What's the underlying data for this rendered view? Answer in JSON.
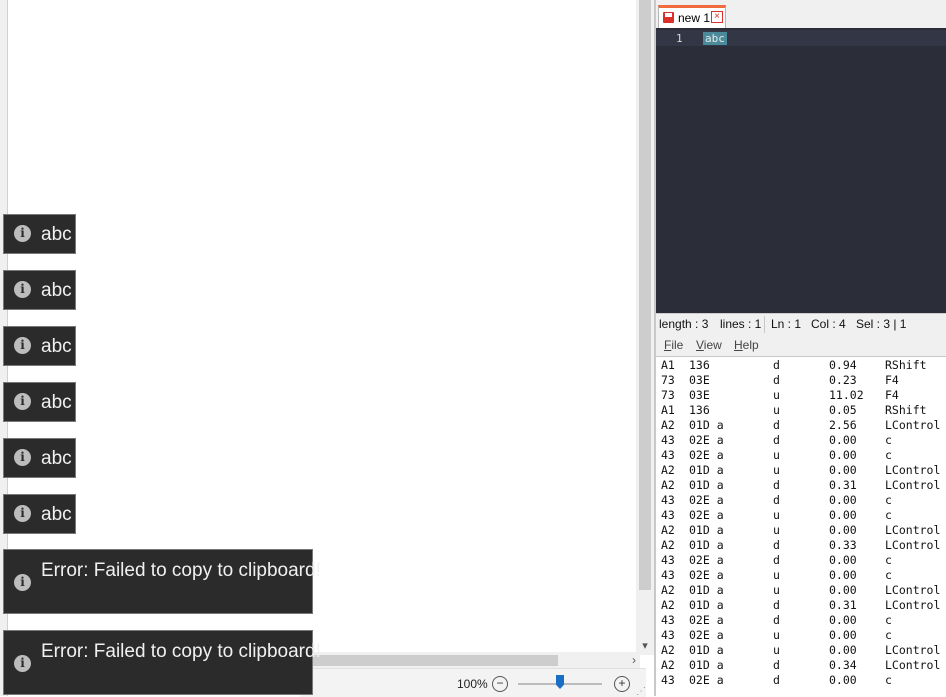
{
  "toasts": [
    {
      "message": "abc"
    },
    {
      "message": "abc"
    },
    {
      "message": "abc"
    },
    {
      "message": "abc"
    },
    {
      "message": "abc"
    },
    {
      "message": "abc"
    },
    {
      "message": "Error: Failed to copy to clipboard!"
    },
    {
      "message": "Error: Failed to copy to clipboard!"
    }
  ],
  "viewer": {
    "zoom": "100%",
    "zoom_minus": "−",
    "zoom_plus": "+"
  },
  "editor": {
    "tab_label": "new 1",
    "line_number": "1",
    "line_text": "abc",
    "status": {
      "length": "length : 3",
      "lines": "lines : 1",
      "ln": "Ln : 1",
      "col": "Col : 4",
      "sel": "Sel : 3 | 1"
    }
  },
  "key_history": {
    "menu": [
      "File",
      "View",
      "Help"
    ],
    "rows": [
      [
        "A1",
        "136",
        "d",
        "0.94",
        "RShift"
      ],
      [
        "73",
        "03E",
        "d",
        "0.23",
        "F4"
      ],
      [
        "73",
        "03E",
        "u",
        "11.02",
        "F4"
      ],
      [
        "A1",
        "136",
        "u",
        "0.05",
        "RShift"
      ],
      [
        "A2",
        "01D a",
        "d",
        "2.56",
        "LControl"
      ],
      [
        "43",
        "02E a",
        "d",
        "0.00",
        "c"
      ],
      [
        "43",
        "02E a",
        "u",
        "0.00",
        "c"
      ],
      [
        "A2",
        "01D a",
        "u",
        "0.00",
        "LControl"
      ],
      [
        "A2",
        "01D a",
        "d",
        "0.31",
        "LControl"
      ],
      [
        "43",
        "02E a",
        "d",
        "0.00",
        "c"
      ],
      [
        "43",
        "02E a",
        "u",
        "0.00",
        "c"
      ],
      [
        "A2",
        "01D a",
        "u",
        "0.00",
        "LControl"
      ],
      [
        "A2",
        "01D a",
        "d",
        "0.33",
        "LControl"
      ],
      [
        "43",
        "02E a",
        "d",
        "0.00",
        "c"
      ],
      [
        "43",
        "02E a",
        "u",
        "0.00",
        "c"
      ],
      [
        "A2",
        "01D a",
        "u",
        "0.00",
        "LControl"
      ],
      [
        "A2",
        "01D a",
        "d",
        "0.31",
        "LControl"
      ],
      [
        "43",
        "02E a",
        "d",
        "0.00",
        "c"
      ],
      [
        "43",
        "02E a",
        "u",
        "0.00",
        "c"
      ],
      [
        "A2",
        "01D a",
        "u",
        "0.00",
        "LControl"
      ],
      [
        "A2",
        "01D a",
        "d",
        "0.34",
        "LControl"
      ],
      [
        "43",
        "02E a",
        "d",
        "0.00",
        "c"
      ]
    ]
  }
}
